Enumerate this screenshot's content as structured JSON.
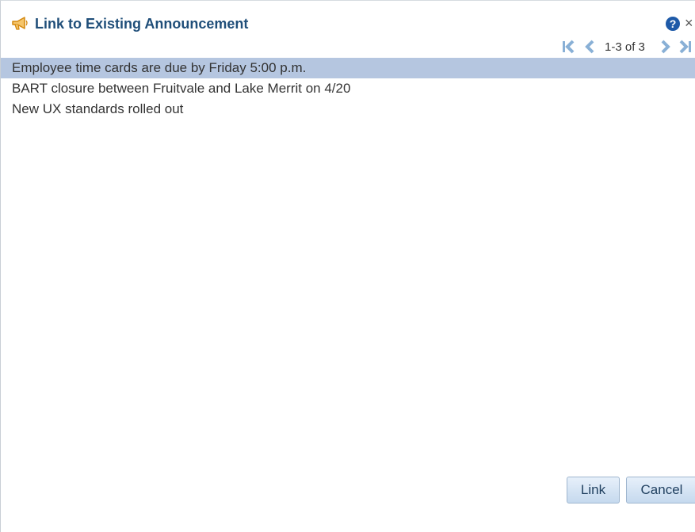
{
  "dialog": {
    "title": "Link to Existing Announcement",
    "close_symbol": "×"
  },
  "icons": {
    "title": "megaphone-icon",
    "help": "help-icon",
    "close": "close-icon",
    "first": "first-page-icon",
    "previous": "previous-page-icon",
    "next": "next-page-icon",
    "last": "last-page-icon"
  },
  "pager": {
    "range_text": "1-3 of 3"
  },
  "announcements": [
    {
      "title": "Employee time cards are due by Friday 5:00 p.m.",
      "selected": true
    },
    {
      "title": "BART closure between Fruitvale and Lake Merrit on 4/20",
      "selected": false
    },
    {
      "title": "New UX standards rolled out",
      "selected": false
    }
  ],
  "buttons": {
    "link": "Link",
    "cancel": "Cancel"
  },
  "colors": {
    "title": "#1f4e79",
    "selection": "#b5c6e0",
    "pager_icon": "#89b0d6",
    "title_icon": "#e8a21a"
  }
}
